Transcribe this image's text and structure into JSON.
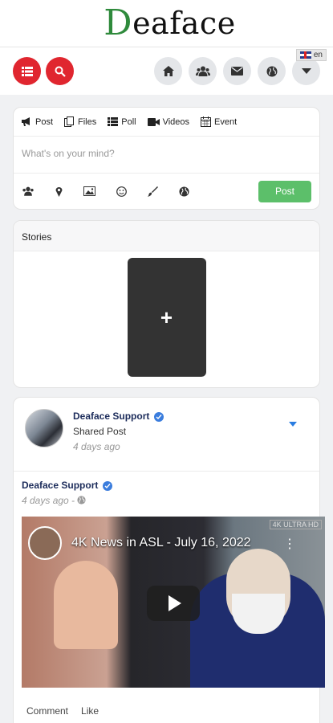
{
  "logo": {
    "initial": "D",
    "rest": "eaface"
  },
  "nav": {
    "lang": "en",
    "left_icons": [
      "list-icon",
      "search-icon"
    ],
    "right_icons": [
      "home-icon",
      "users-icon",
      "mail-icon",
      "globe-icon",
      "caret-down-icon"
    ]
  },
  "composer": {
    "types": [
      {
        "icon": "megaphone-icon",
        "label": "Post"
      },
      {
        "icon": "files-icon",
        "label": "Files"
      },
      {
        "icon": "poll-icon",
        "label": "Poll"
      },
      {
        "icon": "video-icon",
        "label": "Videos"
      },
      {
        "icon": "calendar-icon",
        "label": "Event"
      }
    ],
    "placeholder": "What's on your mind?",
    "tools": [
      "users-icon",
      "location-icon",
      "image-icon",
      "emoji-icon",
      "brush-icon",
      "globe-icon"
    ],
    "post_label": "Post"
  },
  "stories": {
    "title": "Stories",
    "add_label": "+"
  },
  "post": {
    "author": "Deaface Support",
    "kind": "Shared Post",
    "time": "4 days ago",
    "shared_author": "Deaface Support",
    "shared_time": "4 days ago -",
    "video_title": "4K News in ASL - July 16, 2022",
    "video_badge": "4K ULTRA HD",
    "actions": {
      "comment": "Comment",
      "like": "Like"
    }
  }
}
